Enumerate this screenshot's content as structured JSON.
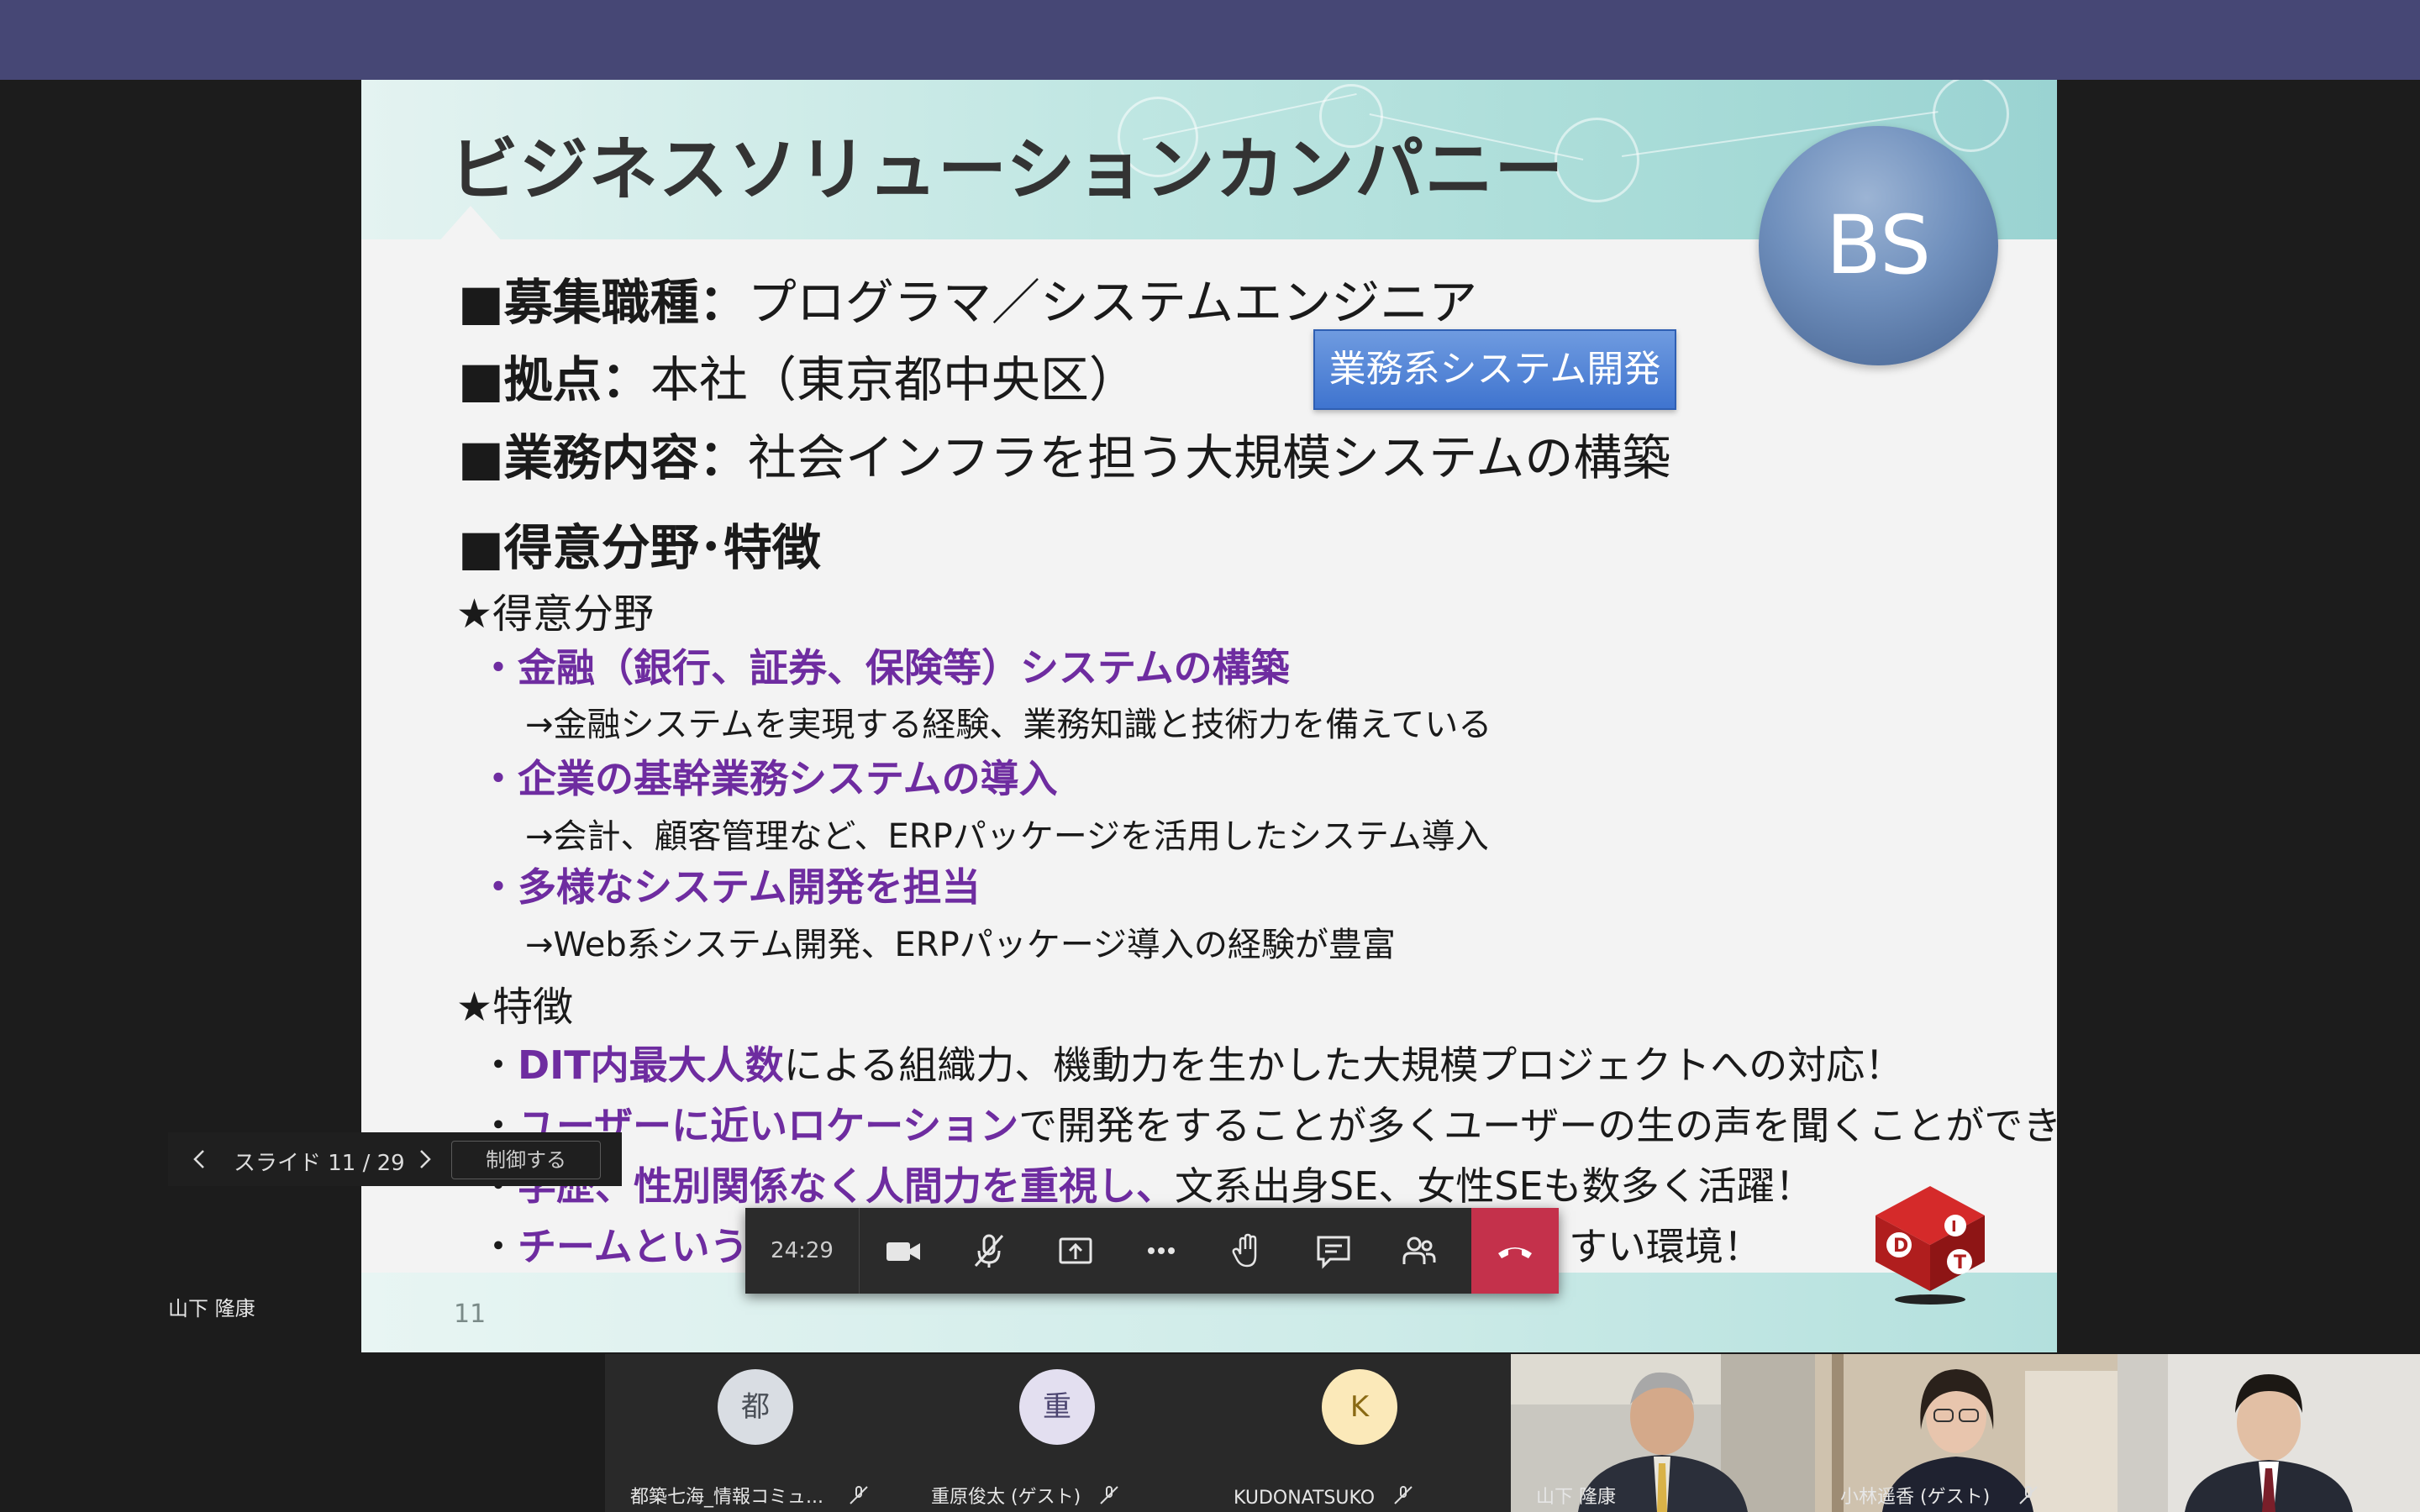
{
  "slide": {
    "title": "ビジネスソリューションカンパニー",
    "badge": "BS",
    "tag": "業務系システム開発",
    "job_label": "■募集職種：",
    "job_value": "プログラマ／システムエンジニア",
    "base_label": "■拠点：",
    "base_value": "本社（東京都中央区）",
    "work_label": "■業務内容：",
    "work_value": "社会インフラを担う大規模システムの構築",
    "strength_heading": "■得意分野･特徴",
    "fields_heading": "★得意分野",
    "item1": "・金融（銀行、証券、保険等）システムの構築",
    "item1_sub": "→金融システムを実現する経験、業務知識と技術力を備えている",
    "item2": "・企業の基幹業務システムの導入",
    "item2_sub": "→会計、顧客管理など、ERPパッケージを活用したシステム導入",
    "item3": "・多様なシステム開発を担当",
    "item3_sub": "→Web系システム開発、ERPパッケージ導入の経験が豊富",
    "features_heading": "★特徴",
    "feat1_bold": "DIT内最大人数",
    "feat1_rest": "による組織力、機動力を生かした大規模プロジェクトへの対応！",
    "feat2_bold": "ユーザーに近いロケーション",
    "feat2_rest": "で開発をすることが多くユーザーの生の声を聞くことができる！",
    "feat3_bold": "学歴、性別関係なく人間力を重視し、",
    "feat3_rest": "文系出身SE、女性SEも数多く活躍！",
    "feat4_bold": "チームという組",
    "feat4_rest": "すい環境！",
    "page_number": "11"
  },
  "slide_nav": {
    "position": "スライド 11 / 29",
    "control": "制御する"
  },
  "presenter_name": "山下 隆康",
  "toolbar": {
    "timer": "24:29",
    "icons": [
      "camera-icon",
      "mic-off-icon",
      "share-icon",
      "more-icon",
      "raise-hand-icon",
      "chat-icon",
      "participants-icon",
      "hangup-icon"
    ]
  },
  "participants": [
    {
      "initial": "都",
      "name": "都築七海_情報コミュ...",
      "avatar_color": "#d9dde3",
      "text_color": "#4a4f57"
    },
    {
      "initial": "重",
      "name": "重原俊太 (ゲスト)",
      "avatar_color": "#e3dff0",
      "text_color": "#4b4470"
    },
    {
      "initial": "K",
      "name": "KUDONATSUKO",
      "avatar_color": "#fbe9b9",
      "text_color": "#8a6a14"
    }
  ],
  "videos": [
    {
      "name": "山下 隆康"
    },
    {
      "name": "小林遥香 (ゲスト)"
    },
    {
      "name": ""
    }
  ],
  "colors": {
    "teams_bar": "#464775",
    "accent_purple": "#6e2ca0",
    "hangup": "#c4314b"
  }
}
